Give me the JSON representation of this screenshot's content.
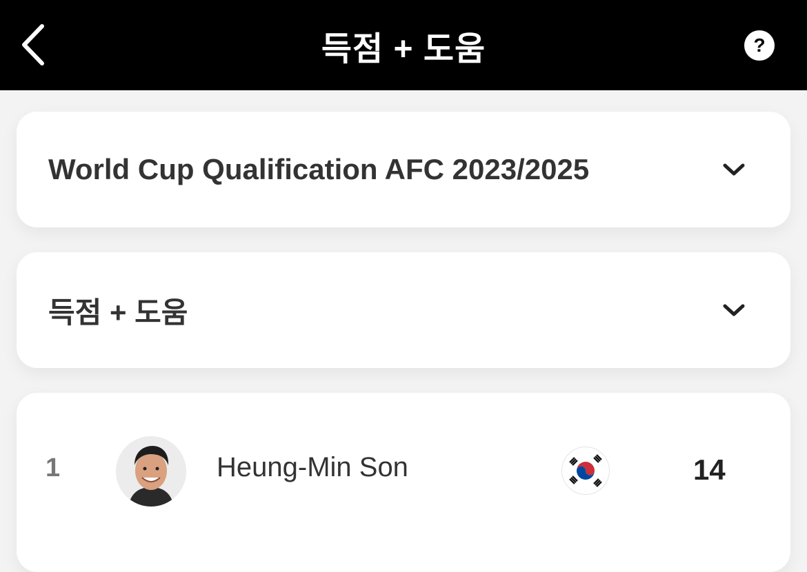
{
  "header": {
    "title": "득점 + 도움",
    "back_icon": "chevron-left-icon",
    "help_icon": "question-mark-icon",
    "help_label": "?"
  },
  "filters": {
    "competition": "World Cup Qualification AFC 2023/2025",
    "stat_type": "득점 + 도움"
  },
  "leaderboard": [
    {
      "rank": "1",
      "player": "Heung-Min Son",
      "country_flag": "south-korea-flag",
      "value": "14"
    }
  ],
  "colors": {
    "header_bg": "#000000",
    "page_bg": "#f3f3f3",
    "card_bg": "#ffffff",
    "text_primary": "#333333"
  }
}
